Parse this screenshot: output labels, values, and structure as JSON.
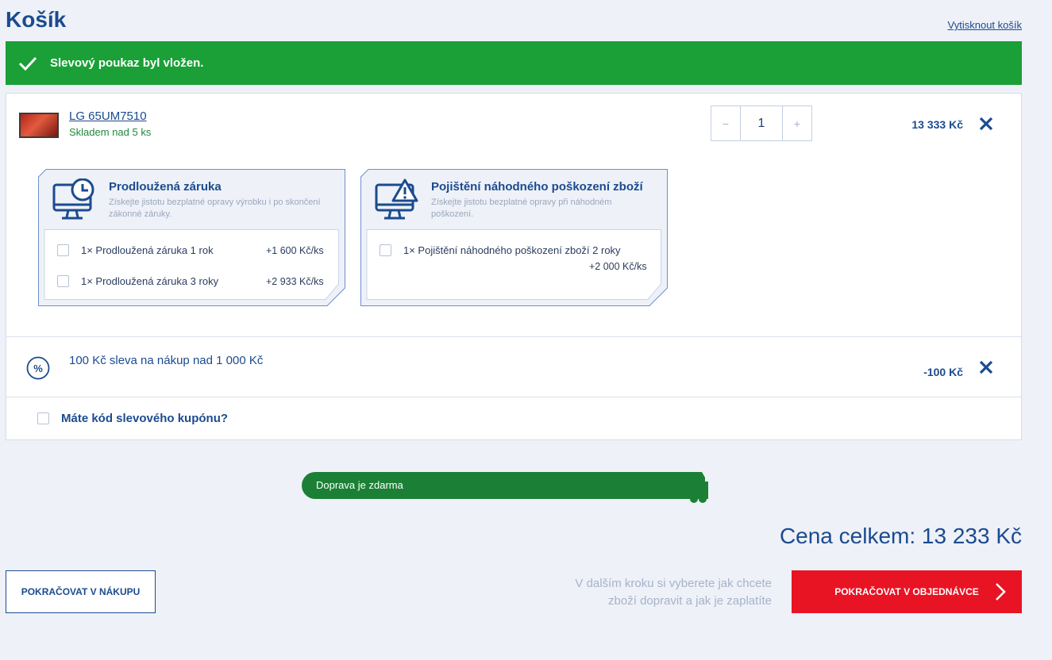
{
  "page": {
    "title": "Košík",
    "print_link": "Vytisknout košík"
  },
  "notice": {
    "message": "Slevový poukaz byl vložen.",
    "color": "#1aa037"
  },
  "product": {
    "name": "LG 65UM7510",
    "stock": "Skladem nad 5 ks",
    "quantity": "1",
    "qty_minus": "−",
    "qty_plus": "+",
    "price": "13 333 Kč"
  },
  "services": [
    {
      "title": "Prodloužená záruka",
      "description": "Získejte jistotu bezplatné opravy výrobku i po skončení zákonné záruky.",
      "icon": "monitor-clock-icon",
      "options": [
        {
          "label": "1× Prodloužená záruka 1 rok",
          "price": "+1 600 Kč/ks"
        },
        {
          "label": "1× Prodloužená záruka 3 roky",
          "price": "+2 933 Kč/ks"
        }
      ]
    },
    {
      "title": "Pojištění náhodného poškození zboží",
      "description": "Získejte jistotu bezplatné opravy při náhodném poškození.",
      "icon": "monitor-warning-icon",
      "options": [
        {
          "label": "1× Pojištění náhodného poškození zboží 2 roky",
          "price": "+2 000 Kč/ks"
        }
      ]
    }
  ],
  "discount": {
    "label": "100 Kč sleva na nákup nad 1 000 Kč",
    "price": "-100 Kč"
  },
  "coupon": {
    "label": "Máte kód slevového kupónu?"
  },
  "shipping": {
    "label": "Doprava je zdarma",
    "progress": 1.0
  },
  "summary": {
    "total": "Cena celkem: 13 233 Kč"
  },
  "actions": {
    "continue_shopping": "POKRAČOVAT V NÁKUPU",
    "hint": "V dalším kroku si vyberete jak chcete zboží dopravit a jak je zaplatíte",
    "continue_order": "POKRAČOVAT V OBJEDNÁVCE",
    "order_color": "#e81424"
  }
}
